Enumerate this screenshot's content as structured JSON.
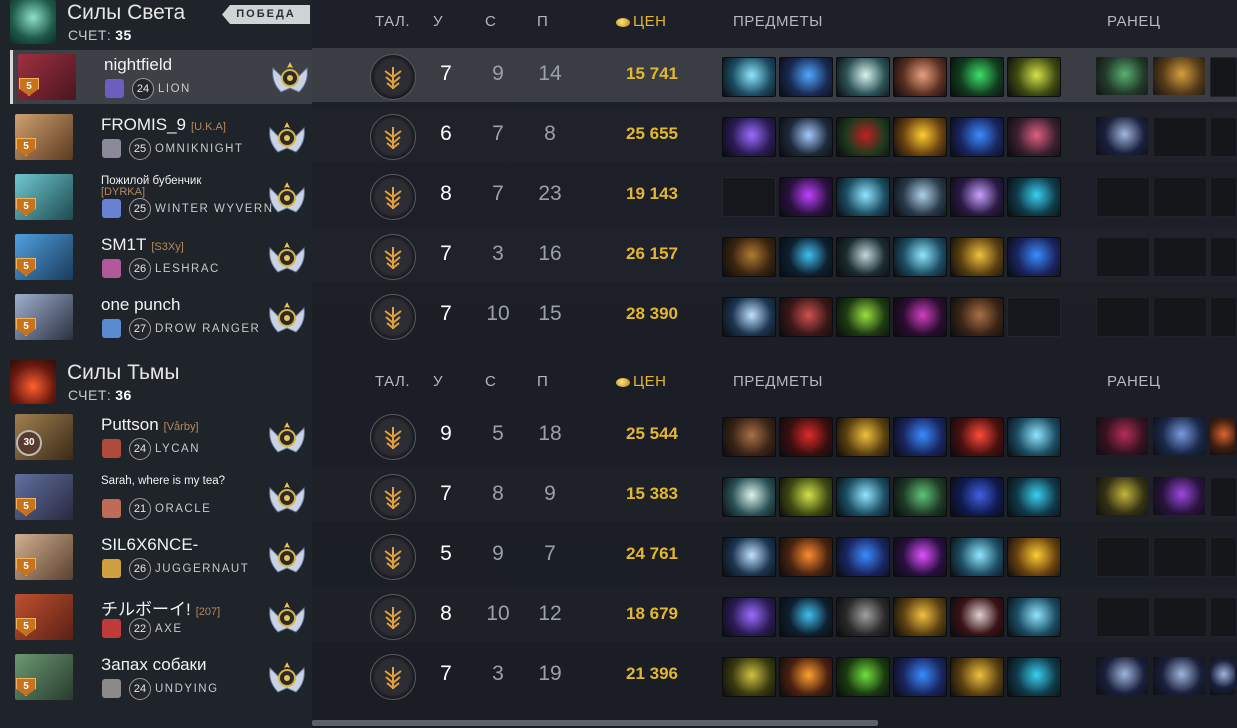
{
  "teams": [
    {
      "name": "Силы Света",
      "score_label": "СЧЕТ:",
      "score": "35",
      "result": "ПОБЕДА",
      "players": [
        {
          "name": "nightfield",
          "tag": "",
          "hero": "LION",
          "level": "24",
          "rank_level": "5",
          "talent_icon": "lion-talent",
          "kills": "7",
          "deaths": "9",
          "assists": "14",
          "gold": "15 741",
          "items": [
            "blade-item",
            "orb-item",
            "wind-lace-item",
            "shield-item",
            "boots-green-item",
            "claw-item"
          ],
          "backpack": [
            "staff-item",
            "pipe-item",
            "empty"
          ]
        },
        {
          "name": "FROMIS_9",
          "tag": "[U.K.A]",
          "hero": "OMNIKNIGHT",
          "level": "25",
          "rank_level": "5",
          "talent_icon": "omni-talent",
          "kills": "6",
          "deaths": "7",
          "assists": "8",
          "gold": "25 655",
          "items": [
            "crescent-item",
            "lance-item",
            "helm-item",
            "gold-sword-item",
            "dagon-item",
            "lotus-item"
          ],
          "backpack": [
            "crystal-item",
            "empty",
            "empty"
          ]
        },
        {
          "name": "Пожилой бубенчик",
          "tag": "[DYRKA]",
          "hero": "WINTER WYVERN",
          "level": "25",
          "rank_level": "5",
          "talent_icon": "wyvern-talent",
          "kills": "8",
          "deaths": "7",
          "assists": "23",
          "gold": "19 143",
          "items": [
            "empty",
            "rod-item",
            "blade-item",
            "cluster-item",
            "chain-item",
            "pot-item"
          ],
          "backpack": [
            "empty",
            "empty",
            "empty"
          ]
        },
        {
          "name": "SM1T",
          "tag": "[S3Xy]",
          "hero": "LESHRAC",
          "level": "26",
          "rank_level": "5",
          "talent_icon": "leshrac-talent",
          "kills": "7",
          "deaths": "3",
          "assists": "16",
          "gold": "26 157",
          "items": [
            "boots-item",
            "cross-item",
            "mask-item",
            "blade-item",
            "helm-gold-item",
            "dagon-item"
          ],
          "backpack": [
            "empty",
            "empty",
            "empty"
          ]
        },
        {
          "name": "one punch",
          "tag": "",
          "hero": "DROW RANGER",
          "level": "27",
          "rank_level": "5",
          "talent_icon": "drow-talent",
          "kills": "7",
          "deaths": "10",
          "assists": "15",
          "gold": "28 390",
          "items": [
            "moon-item",
            "axe-item",
            "green-blade-item",
            "purple-blade-item",
            "leather-boots-item",
            "empty"
          ],
          "backpack": [
            "empty",
            "empty",
            "empty"
          ]
        }
      ]
    },
    {
      "name": "Силы Тьмы",
      "score_label": "СЧЕТ:",
      "score": "36",
      "players": [
        {
          "name": "Puttson",
          "tag": "[Vårby]",
          "hero": "LYCAN",
          "level": "24",
          "rank_level": "30",
          "talent_icon": "lycan-talent",
          "kills": "9",
          "deaths": "5",
          "assists": "18",
          "gold": "25 544",
          "items": [
            "leather-boots-item",
            "red-helm-item",
            "helm-gold-item",
            "dagon-item",
            "red-axe-item",
            "blade-item"
          ],
          "backpack": [
            "crimson-item",
            "bottle-item",
            "ring-item"
          ]
        },
        {
          "name": "Sarah, where is my tea?",
          "tag": "",
          "hero": "ORACLE",
          "level": "21",
          "rank_level": "5",
          "talent_icon": "oracle-talent",
          "kills": "7",
          "deaths": "8",
          "assists": "9",
          "gold": "15 383",
          "items": [
            "wind-lace-item",
            "claw-item",
            "blade-item",
            "staff-item",
            "cape-item",
            "pot-item"
          ],
          "backpack": [
            "gem-item",
            "orb-purple-item",
            "empty"
          ]
        },
        {
          "name": "SIL6X6NCE-",
          "tag": "",
          "hero": "JUGGERNAUT",
          "level": "26",
          "rank_level": "5",
          "talent_icon": "jugg-talent",
          "kills": "5",
          "deaths": "9",
          "assists": "7",
          "gold": "24 761",
          "items": [
            "moon-item",
            "fire-axe-item",
            "dagon-item",
            "spiral-item",
            "blade-item",
            "gold-sword-item"
          ],
          "backpack": [
            "empty",
            "empty",
            "empty"
          ]
        },
        {
          "name": "チルボーイ!",
          "tag": "[207]",
          "hero": "AXE",
          "level": "22",
          "rank_level": "5",
          "talent_icon": "axe-talent",
          "kills": "8",
          "deaths": "10",
          "assists": "12",
          "gold": "18 679",
          "items": [
            "crescent-item",
            "cross-item",
            "spike-item",
            "helm-gold-item",
            "vanguard-item",
            "blade-item"
          ],
          "backpack": [
            "empty",
            "empty",
            "empty"
          ]
        },
        {
          "name": "Запах собаки",
          "tag": "",
          "hero": "UNDYING",
          "level": "24",
          "rank_level": "5",
          "talent_icon": "undying-talent",
          "kills": "7",
          "deaths": "3",
          "assists": "19",
          "gold": "21 396",
          "items": [
            "horn-item",
            "fire-orb-item",
            "green-sword-item",
            "dagon-item",
            "helm-gold-item",
            "pot-item"
          ],
          "backpack": [
            "crystal-item",
            "crystal-item",
            "crystal-item"
          ]
        }
      ]
    }
  ],
  "columns": {
    "talent": "ТАЛ.",
    "kills": "У",
    "deaths": "С",
    "assists": "П",
    "net_worth": "ЦЕН",
    "items": "ПРЕДМЕТЫ",
    "backpack": "РАНЕЦ"
  },
  "colors": {
    "gold": "#e4b733",
    "victory_bg": "#cfd3d6",
    "tag": "#b98a5c"
  }
}
